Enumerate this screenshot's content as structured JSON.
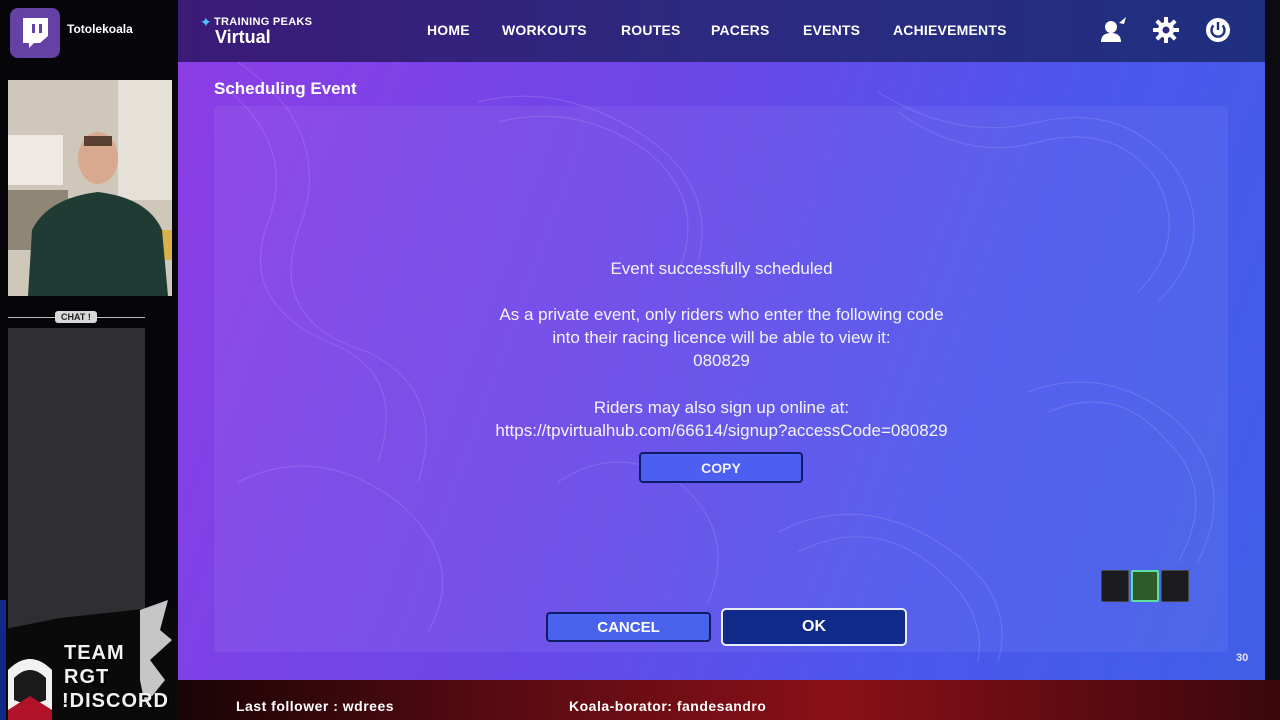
{
  "overlay": {
    "streamer_name": "Totolekoala",
    "chat_label": "CHAT !",
    "team_lines": [
      "TEAM",
      "RGT",
      "!DISCORD"
    ],
    "ticker": {
      "last_follower": "Last follower : wdrees",
      "collaborator": "Koala-borator: fandesandro"
    }
  },
  "app": {
    "brand_top": "TRAINING PEAKS",
    "brand_bottom": "Virtual",
    "nav": [
      "HOME",
      "WORKOUTS",
      "ROUTES",
      "PACERS",
      "EVENTS",
      "ACHIEVEMENTS"
    ],
    "icons": [
      "profile-icon",
      "gear-icon",
      "power-icon"
    ]
  },
  "dialog": {
    "title": "Scheduling Event",
    "success": "Event successfully scheduled",
    "private_line1": "As a private event, only riders who enter the following code",
    "private_line2": "into their racing licence will be able to view it:",
    "access_code": "080829",
    "signup_line": "Riders may also sign up online at:",
    "signup_url": "https://tpvirtualhub.com/66614/signup?accessCode=080829",
    "copy_label": "COPY",
    "cancel_label": "CANCEL",
    "ok_label": "OK"
  },
  "page_number": "30",
  "colors": {
    "accent_purple": "#8d3de6",
    "accent_blue": "#3f5fe8",
    "ok_button": "#0f2a88",
    "ticker_red": "#8a1018"
  }
}
